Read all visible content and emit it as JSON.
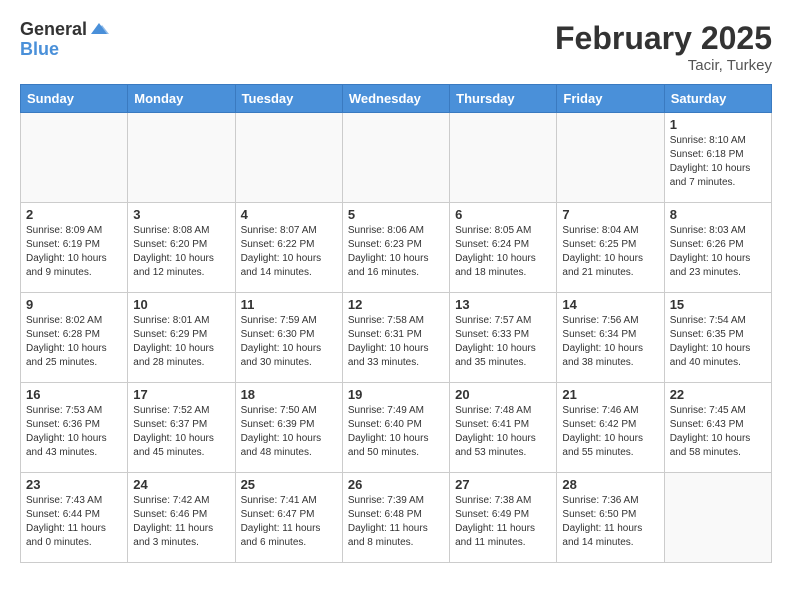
{
  "header": {
    "logo_general": "General",
    "logo_blue": "Blue",
    "title": "February 2025",
    "location": "Tacir, Turkey"
  },
  "columns": [
    "Sunday",
    "Monday",
    "Tuesday",
    "Wednesday",
    "Thursday",
    "Friday",
    "Saturday"
  ],
  "weeks": [
    [
      {
        "day": "",
        "info": ""
      },
      {
        "day": "",
        "info": ""
      },
      {
        "day": "",
        "info": ""
      },
      {
        "day": "",
        "info": ""
      },
      {
        "day": "",
        "info": ""
      },
      {
        "day": "",
        "info": ""
      },
      {
        "day": "1",
        "info": "Sunrise: 8:10 AM\nSunset: 6:18 PM\nDaylight: 10 hours\nand 7 minutes."
      }
    ],
    [
      {
        "day": "2",
        "info": "Sunrise: 8:09 AM\nSunset: 6:19 PM\nDaylight: 10 hours\nand 9 minutes."
      },
      {
        "day": "3",
        "info": "Sunrise: 8:08 AM\nSunset: 6:20 PM\nDaylight: 10 hours\nand 12 minutes."
      },
      {
        "day": "4",
        "info": "Sunrise: 8:07 AM\nSunset: 6:22 PM\nDaylight: 10 hours\nand 14 minutes."
      },
      {
        "day": "5",
        "info": "Sunrise: 8:06 AM\nSunset: 6:23 PM\nDaylight: 10 hours\nand 16 minutes."
      },
      {
        "day": "6",
        "info": "Sunrise: 8:05 AM\nSunset: 6:24 PM\nDaylight: 10 hours\nand 18 minutes."
      },
      {
        "day": "7",
        "info": "Sunrise: 8:04 AM\nSunset: 6:25 PM\nDaylight: 10 hours\nand 21 minutes."
      },
      {
        "day": "8",
        "info": "Sunrise: 8:03 AM\nSunset: 6:26 PM\nDaylight: 10 hours\nand 23 minutes."
      }
    ],
    [
      {
        "day": "9",
        "info": "Sunrise: 8:02 AM\nSunset: 6:28 PM\nDaylight: 10 hours\nand 25 minutes."
      },
      {
        "day": "10",
        "info": "Sunrise: 8:01 AM\nSunset: 6:29 PM\nDaylight: 10 hours\nand 28 minutes."
      },
      {
        "day": "11",
        "info": "Sunrise: 7:59 AM\nSunset: 6:30 PM\nDaylight: 10 hours\nand 30 minutes."
      },
      {
        "day": "12",
        "info": "Sunrise: 7:58 AM\nSunset: 6:31 PM\nDaylight: 10 hours\nand 33 minutes."
      },
      {
        "day": "13",
        "info": "Sunrise: 7:57 AM\nSunset: 6:33 PM\nDaylight: 10 hours\nand 35 minutes."
      },
      {
        "day": "14",
        "info": "Sunrise: 7:56 AM\nSunset: 6:34 PM\nDaylight: 10 hours\nand 38 minutes."
      },
      {
        "day": "15",
        "info": "Sunrise: 7:54 AM\nSunset: 6:35 PM\nDaylight: 10 hours\nand 40 minutes."
      }
    ],
    [
      {
        "day": "16",
        "info": "Sunrise: 7:53 AM\nSunset: 6:36 PM\nDaylight: 10 hours\nand 43 minutes."
      },
      {
        "day": "17",
        "info": "Sunrise: 7:52 AM\nSunset: 6:37 PM\nDaylight: 10 hours\nand 45 minutes."
      },
      {
        "day": "18",
        "info": "Sunrise: 7:50 AM\nSunset: 6:39 PM\nDaylight: 10 hours\nand 48 minutes."
      },
      {
        "day": "19",
        "info": "Sunrise: 7:49 AM\nSunset: 6:40 PM\nDaylight: 10 hours\nand 50 minutes."
      },
      {
        "day": "20",
        "info": "Sunrise: 7:48 AM\nSunset: 6:41 PM\nDaylight: 10 hours\nand 53 minutes."
      },
      {
        "day": "21",
        "info": "Sunrise: 7:46 AM\nSunset: 6:42 PM\nDaylight: 10 hours\nand 55 minutes."
      },
      {
        "day": "22",
        "info": "Sunrise: 7:45 AM\nSunset: 6:43 PM\nDaylight: 10 hours\nand 58 minutes."
      }
    ],
    [
      {
        "day": "23",
        "info": "Sunrise: 7:43 AM\nSunset: 6:44 PM\nDaylight: 11 hours\nand 0 minutes."
      },
      {
        "day": "24",
        "info": "Sunrise: 7:42 AM\nSunset: 6:46 PM\nDaylight: 11 hours\nand 3 minutes."
      },
      {
        "day": "25",
        "info": "Sunrise: 7:41 AM\nSunset: 6:47 PM\nDaylight: 11 hours\nand 6 minutes."
      },
      {
        "day": "26",
        "info": "Sunrise: 7:39 AM\nSunset: 6:48 PM\nDaylight: 11 hours\nand 8 minutes."
      },
      {
        "day": "27",
        "info": "Sunrise: 7:38 AM\nSunset: 6:49 PM\nDaylight: 11 hours\nand 11 minutes."
      },
      {
        "day": "28",
        "info": "Sunrise: 7:36 AM\nSunset: 6:50 PM\nDaylight: 11 hours\nand 14 minutes."
      },
      {
        "day": "",
        "info": ""
      }
    ]
  ]
}
